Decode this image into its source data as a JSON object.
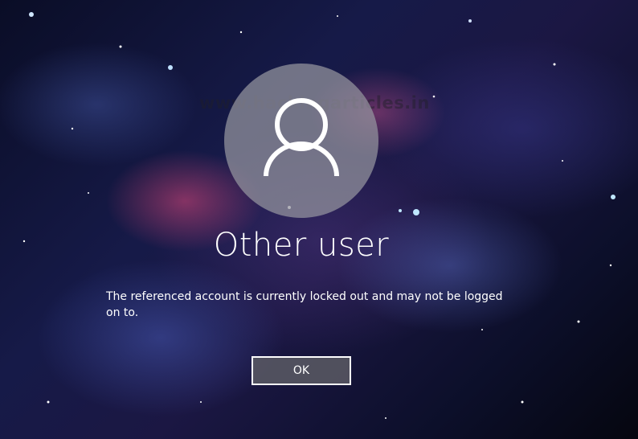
{
  "watermark": {
    "text": "www.hackingarticles.in"
  },
  "login": {
    "avatar_icon": "user-icon",
    "username": "Other user",
    "message": "The referenced account is currently locked out and may not be logged on to.",
    "ok_label": "OK"
  }
}
